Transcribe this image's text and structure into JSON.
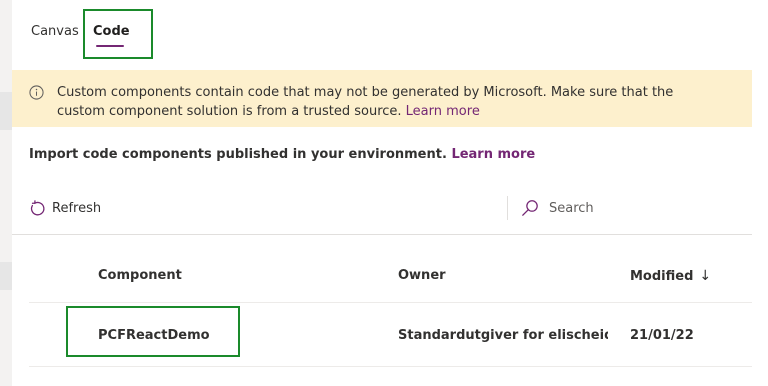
{
  "tabs": {
    "canvas": "Canvas",
    "code": "Code"
  },
  "warning": {
    "text": "Custom components contain code that may not be generated by Microsoft. Make sure that the custom component solution is from a trusted source. ",
    "link": "Learn more"
  },
  "import": {
    "text": "Import code components published in your environment. ",
    "link": "Learn more"
  },
  "toolbar": {
    "refresh": "Refresh",
    "search_placeholder": "Search"
  },
  "table": {
    "headers": {
      "component": "Component",
      "owner": "Owner",
      "modified": "Modified",
      "sort_arrow": "↓"
    },
    "rows": [
      {
        "component": "PCFReactDemo",
        "owner": "Standardutgiver for elischeidev...",
        "modified": "21/01/22"
      }
    ]
  },
  "colors": {
    "accent": "#742774",
    "warning_bg": "#fdf0cd",
    "highlight": "#1a8a2b"
  }
}
